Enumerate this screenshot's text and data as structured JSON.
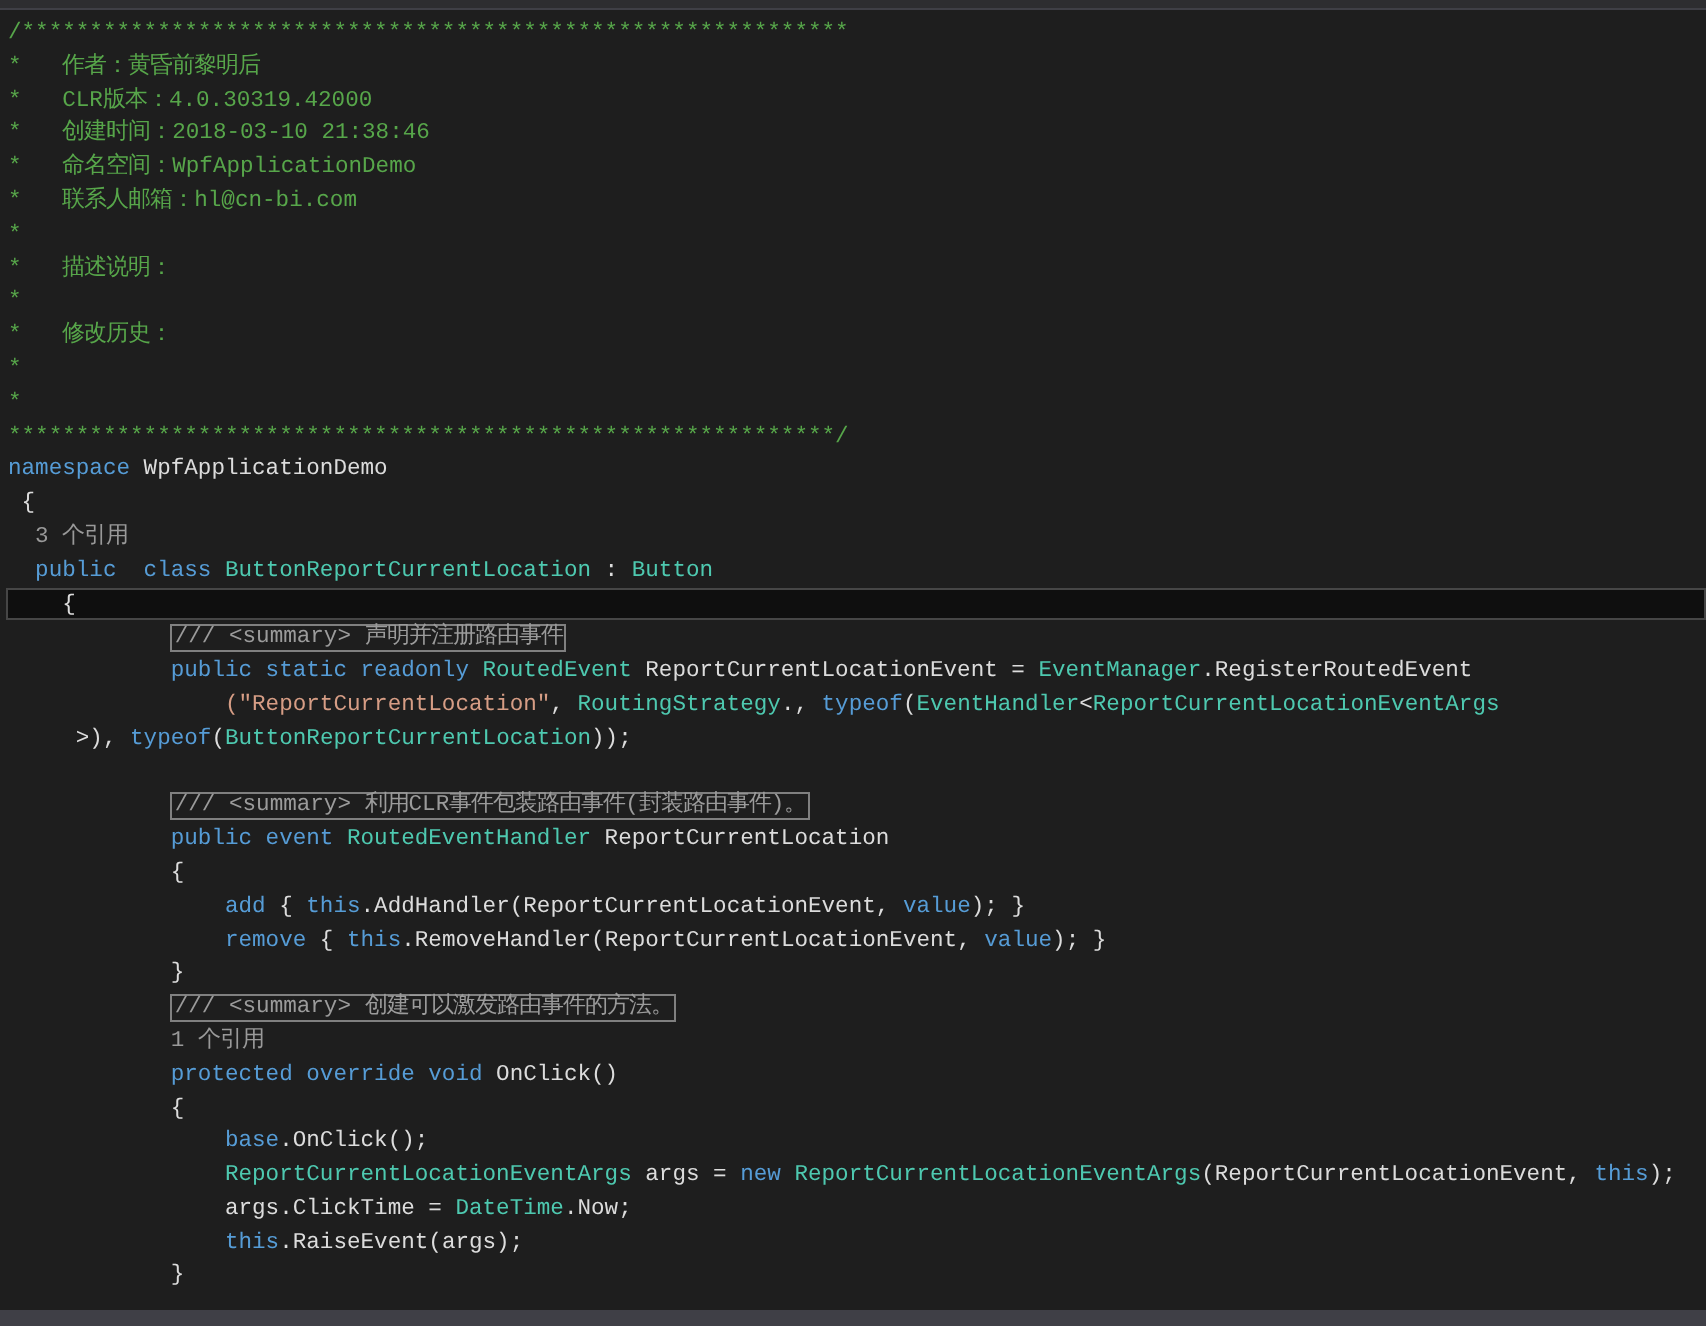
{
  "lines": [
    {
      "tokens": [
        {
          "text": "/*************************************************************",
          "kind": "comment"
        }
      ]
    },
    {
      "tokens": [
        {
          "text": "*   作者：黄昏前黎明后",
          "kind": "comment"
        }
      ]
    },
    {
      "tokens": [
        {
          "text": "*   CLR版本：4.0.30319.42000",
          "kind": "comment"
        }
      ]
    },
    {
      "tokens": [
        {
          "text": "*   创建时间：2018-03-10 21:38:46",
          "kind": "comment"
        }
      ]
    },
    {
      "tokens": [
        {
          "text": "*   命名空间：WpfApplicationDemo",
          "kind": "comment"
        }
      ]
    },
    {
      "tokens": [
        {
          "text": "*   联系人邮箱：hl@cn-bi.com",
          "kind": "comment"
        }
      ]
    },
    {
      "tokens": [
        {
          "text": "*",
          "kind": "comment"
        }
      ]
    },
    {
      "tokens": [
        {
          "text": "*   描述说明：",
          "kind": "comment"
        }
      ]
    },
    {
      "tokens": [
        {
          "text": "*",
          "kind": "comment"
        }
      ]
    },
    {
      "tokens": [
        {
          "text": "*   修改历史：",
          "kind": "comment"
        }
      ]
    },
    {
      "tokens": [
        {
          "text": "*",
          "kind": "comment"
        }
      ]
    },
    {
      "tokens": [
        {
          "text": "*",
          "kind": "comment"
        }
      ]
    },
    {
      "tokens": [
        {
          "text": "*************************************************************/",
          "kind": "comment"
        }
      ]
    },
    {
      "tokens": [
        {
          "text": "namespace",
          "kind": "keyword"
        },
        {
          "text": " WpfApplicationDemo",
          "kind": "plain"
        }
      ]
    },
    {
      "tokens": [
        {
          "text": " {",
          "kind": "plain"
        }
      ]
    },
    {
      "tokens": [
        {
          "text": "  3 个引用",
          "kind": "lens"
        }
      ]
    },
    {
      "tokens": [
        {
          "text": "  public  class",
          "kind": "keyword"
        },
        {
          "text": " ButtonReportCurrentLocation",
          "kind": "type"
        },
        {
          "text": " : ",
          "kind": "plain"
        },
        {
          "text": "Button",
          "kind": "type"
        }
      ]
    },
    {
      "current": true,
      "tokens": [
        {
          "text": "    {",
          "kind": "plain"
        }
      ]
    },
    {
      "tokens": [
        {
          "text": "            /// <summary> 声明并注册路由事件",
          "kind": "doc"
        }
      ]
    },
    {
      "tokens": [
        {
          "text": "            public static readonly",
          "kind": "keyword"
        },
        {
          "text": " RoutedEvent",
          "kind": "type"
        },
        {
          "text": " ReportCurrentLocationEvent = ",
          "kind": "plain"
        },
        {
          "text": "EventManager",
          "kind": "type"
        },
        {
          "text": ".RegisterRoutedEvent",
          "kind": "plain"
        }
      ]
    },
    {
      "tokens": [
        {
          "text": "                (\"ReportCurrentLocation\"",
          "kind": "string"
        },
        {
          "text": ", ",
          "kind": "plain"
        },
        {
          "text": "RoutingStrategy",
          "kind": "type"
        },
        {
          "text": "., ",
          "kind": "plain"
        },
        {
          "text": "typeof",
          "kind": "keyword"
        },
        {
          "text": "(",
          "kind": "plain"
        },
        {
          "text": "EventHandler",
          "kind": "type"
        },
        {
          "text": "<",
          "kind": "plain"
        },
        {
          "text": "ReportCurrentLocationEventArgs",
          "kind": "type"
        }
      ]
    },
    {
      "tokens": [
        {
          "text": "     >), ",
          "kind": "plain"
        },
        {
          "text": "typeof",
          "kind": "keyword"
        },
        {
          "text": "(",
          "kind": "plain"
        },
        {
          "text": "ButtonReportCurrentLocation",
          "kind": "type"
        },
        {
          "text": "));",
          "kind": "plain"
        }
      ]
    },
    {
      "gap_before": true,
      "tokens": [
        {
          "text": "            /// <summary> 利用CLR事件包装路由事件(封装路由事件)。",
          "kind": "doc"
        }
      ]
    },
    {
      "tokens": [
        {
          "text": "            public event",
          "kind": "keyword"
        },
        {
          "text": " RoutedEventHandler",
          "kind": "type"
        },
        {
          "text": " ReportCurrentLocation",
          "kind": "plain"
        }
      ]
    },
    {
      "tokens": [
        {
          "text": "            {",
          "kind": "plain"
        }
      ]
    },
    {
      "tokens": [
        {
          "text": "                add",
          "kind": "keyword"
        },
        {
          "text": " { ",
          "kind": "plain"
        },
        {
          "text": "this",
          "kind": "keyword"
        },
        {
          "text": ".AddHandler(ReportCurrentLocationEvent, ",
          "kind": "plain"
        },
        {
          "text": "value",
          "kind": "keyword"
        },
        {
          "text": "); }",
          "kind": "plain"
        }
      ]
    },
    {
      "tokens": [
        {
          "text": "                remove",
          "kind": "keyword"
        },
        {
          "text": " { ",
          "kind": "plain"
        },
        {
          "text": "this",
          "kind": "keyword"
        },
        {
          "text": ".RemoveHandler(ReportCurrentLocationEvent, ",
          "kind": "plain"
        },
        {
          "text": "value",
          "kind": "keyword"
        },
        {
          "text": "); }",
          "kind": "plain"
        }
      ]
    },
    {
      "tokens": [
        {
          "text": "            }",
          "kind": "plain"
        }
      ]
    },
    {
      "tokens": [
        {
          "text": "            /// <summary> 创建可以激发路由事件的方法。",
          "kind": "doc"
        }
      ]
    },
    {
      "tokens": [
        {
          "text": "            1 个引用",
          "kind": "lens"
        }
      ]
    },
    {
      "tokens": [
        {
          "text": "            protected override void",
          "kind": "keyword"
        },
        {
          "text": " OnClick()",
          "kind": "plain"
        }
      ]
    },
    {
      "tokens": [
        {
          "text": "            {",
          "kind": "plain"
        }
      ]
    },
    {
      "tokens": [
        {
          "text": "                base",
          "kind": "keyword"
        },
        {
          "text": ".OnClick();",
          "kind": "plain"
        }
      ]
    },
    {
      "tokens": [
        {
          "text": "                ReportCurrentLocationEventArgs",
          "kind": "type"
        },
        {
          "text": " args = ",
          "kind": "plain"
        },
        {
          "text": "new",
          "kind": "keyword"
        },
        {
          "text": " ReportCurrentLocationEventArgs",
          "kind": "type"
        },
        {
          "text": "(ReportCurrentLocationEvent, ",
          "kind": "plain"
        },
        {
          "text": "this",
          "kind": "keyword"
        },
        {
          "text": ");",
          "kind": "plain"
        }
      ]
    },
    {
      "tokens": [
        {
          "text": "                args.ClickTime = ",
          "kind": "plain"
        },
        {
          "text": "DateTime",
          "kind": "type"
        },
        {
          "text": ".Now;",
          "kind": "plain"
        }
      ]
    },
    {
      "tokens": [
        {
          "text": "                this",
          "kind": "keyword"
        },
        {
          "text": ".RaiseEvent(args);",
          "kind": "plain"
        }
      ]
    },
    {
      "tokens": [
        {
          "text": "            }",
          "kind": "plain"
        }
      ]
    }
  ]
}
